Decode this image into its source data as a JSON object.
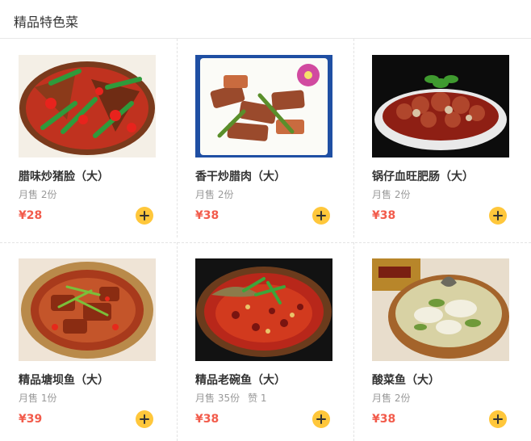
{
  "section": {
    "title": "精品特色菜"
  },
  "colors": {
    "price": "#f25b4b",
    "add_button": "#ffc73b",
    "muted": "#999999"
  },
  "dishes": [
    {
      "name": "腊味炒猪脸（大）",
      "sales": "月售 2份",
      "likes": "",
      "price": "¥28",
      "image_icon": "dish-photo"
    },
    {
      "name": "香干炒腊肉（大）",
      "sales": "月售 2份",
      "likes": "",
      "price": "¥38",
      "image_icon": "dish-photo"
    },
    {
      "name": "锅仔血旺肥肠（大）",
      "sales": "月售 2份",
      "likes": "",
      "price": "¥38",
      "image_icon": "dish-photo"
    },
    {
      "name": "精品塘坝鱼（大）",
      "sales": "月售 1份",
      "likes": "",
      "price": "¥39",
      "image_icon": "dish-photo"
    },
    {
      "name": "精品老碗鱼（大）",
      "sales": "月售 35份",
      "likes": "赞 1",
      "price": "¥38",
      "image_icon": "dish-photo"
    },
    {
      "name": "酸菜鱼（大）",
      "sales": "月售 2份",
      "likes": "",
      "price": "¥38",
      "image_icon": "dish-photo"
    }
  ]
}
